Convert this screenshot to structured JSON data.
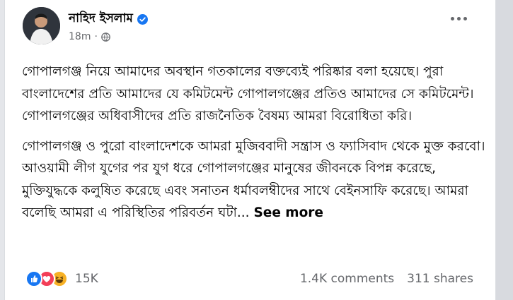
{
  "author": {
    "name": "নাহিদ ইসলাম",
    "time": "18m"
  },
  "post": {
    "paragraph1": "গোপালগঞ্জ নিয়ে আমাদের অবস্থান গতকালের বক্তব্যেই পরিষ্কার বলা হয়েছে। পুরা বাংলাদেশের প্রতি আমাদের যে কমিটমেন্ট গোপালগঞ্জের প্রতিও আমাদের সে কমিটমেন্ট। গোপালগঞ্জের অধিবাসীদের প্রতি রাজনৈতিক বৈষম্য আমরা বিরোধিতা করি।",
    "paragraph2": "গোপালগঞ্জ ও পুরো বাংলাদেশকে আমরা মুজিববাদী সন্ত্রাস ও ফ্যাসিবাদ থেকে মুক্ত করবো। আওয়ামী লীগ যুগের পর যুগ ধরে গোপালগঞ্জের মানুষের জীবনকে বিপন্ন করেছে, মুক্তিযুদ্ধকে কলুষিত করেছে এবং সনাতন ধর্মাবলম্বীদের সাথে বেইনসাফি করেছে। আমরা বলেছি আমরা এ পরিস্থিতির পরিবর্তন ঘটা...",
    "see_more": "See more"
  },
  "engagement": {
    "reactions_count": "15K",
    "comments": "1.4K comments",
    "shares": "311 shares",
    "reaction_icons": [
      "like-icon",
      "love-icon",
      "haha-icon"
    ]
  },
  "colors": {
    "like": "#1877f2",
    "love": "#f33e58",
    "haha": "#f7b125",
    "verified": "#1877f2"
  }
}
